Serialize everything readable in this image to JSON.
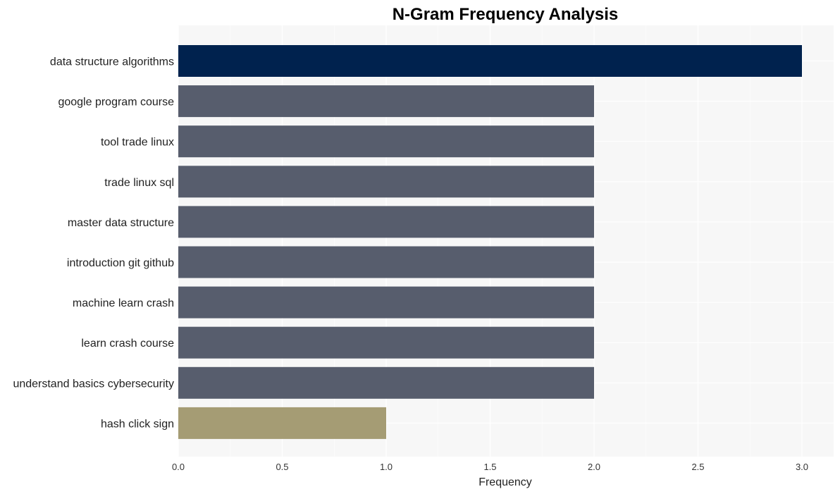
{
  "chart_data": {
    "type": "bar",
    "orientation": "horizontal",
    "title": "N-Gram Frequency Analysis",
    "xlabel": "Frequency",
    "ylabel": "",
    "categories": [
      "data structure algorithms",
      "google program course",
      "tool trade linux",
      "trade linux sql",
      "master data structure",
      "introduction git github",
      "machine learn crash",
      "learn crash course",
      "understand basics cybersecurity",
      "hash click sign"
    ],
    "values": [
      3,
      2,
      2,
      2,
      2,
      2,
      2,
      2,
      2,
      1
    ],
    "bar_colors": [
      "#00224e",
      "#575d6d",
      "#575d6d",
      "#575d6d",
      "#575d6d",
      "#575d6d",
      "#575d6d",
      "#575d6d",
      "#575d6d",
      "#a59c74"
    ],
    "xlim": [
      0,
      3.15
    ],
    "xticks": [
      0.0,
      0.5,
      1.0,
      1.5,
      2.0,
      2.5,
      3.0
    ],
    "xtick_labels": [
      "0.0",
      "0.5",
      "1.0",
      "1.5",
      "2.0",
      "2.5",
      "3.0"
    ],
    "grid": true,
    "background": "#f7f7f7",
    "grid_color": "#ffffff"
  }
}
